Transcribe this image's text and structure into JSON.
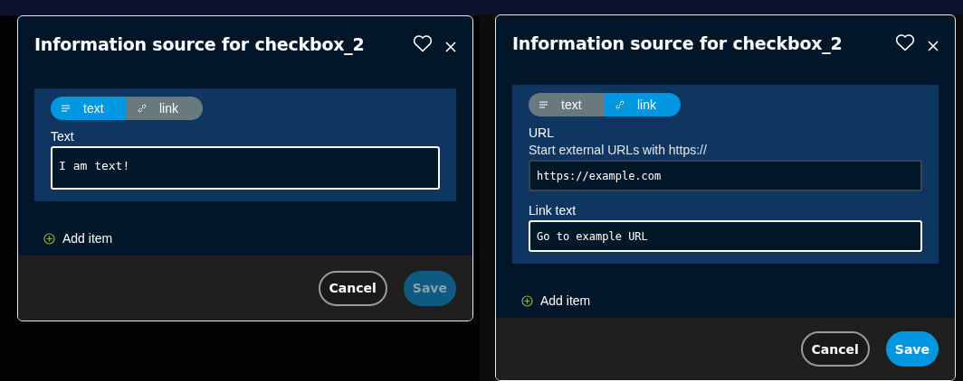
{
  "panels": [
    {
      "dialog": {
        "title": "Information source for checkbox_2",
        "items": [
          {
            "tabs": [
              {
                "label": "text",
                "kind": "text",
                "selected": true
              },
              {
                "label": "link",
                "kind": "link",
                "selected": false
              }
            ],
            "fields": [
              {
                "kind": "textarea",
                "label": "Text",
                "value": "I am text!",
                "focused": true
              }
            ]
          }
        ],
        "add_item": "Add item",
        "buttons": [
          {
            "kind": "secondary",
            "label": "Cancel"
          },
          {
            "kind": "primary",
            "label": "Save",
            "disabled": true
          }
        ]
      }
    },
    {
      "dialog": {
        "title": "Information source for checkbox_2",
        "items": [
          {
            "tabs": [
              {
                "label": "text",
                "kind": "text",
                "selected": false
              },
              {
                "label": "link",
                "kind": "link",
                "selected": true
              }
            ],
            "fields": [
              {
                "kind": "input",
                "label": "URL",
                "hint": "Start external URLs with https://",
                "value": "https://example.com",
                "focused": false
              },
              {
                "kind": "input",
                "label": "Link text",
                "value": "Go to example URL",
                "focused": true
              }
            ]
          }
        ],
        "add_item": "Add item",
        "buttons": [
          {
            "kind": "secondary",
            "label": "Cancel"
          },
          {
            "kind": "primary",
            "label": "Save",
            "disabled": false
          }
        ]
      }
    }
  ]
}
